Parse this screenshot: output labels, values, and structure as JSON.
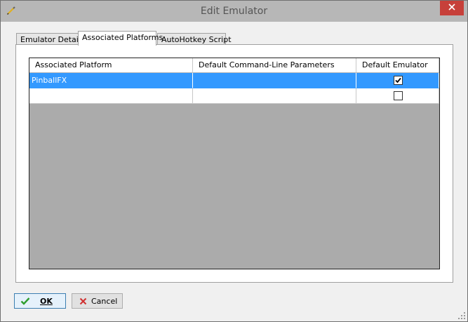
{
  "window": {
    "title": "Edit Emulator"
  },
  "tabs": [
    {
      "label": "Emulator Details",
      "active": false
    },
    {
      "label": "Associated Platforms",
      "active": true
    },
    {
      "label": "AutoHotkey Script",
      "active": false
    }
  ],
  "grid": {
    "columns": [
      "Associated Platform",
      "Default Command-Line Parameters",
      "Default Emulator"
    ],
    "rows": [
      {
        "platform": "PinballFX",
        "parameters": "",
        "default_emulator": true,
        "selected": true
      },
      {
        "platform": "",
        "parameters": "",
        "default_emulator": false,
        "selected": false
      }
    ]
  },
  "buttons": {
    "ok_label": "OK",
    "cancel_label": "Cancel"
  },
  "colors": {
    "titlebar": "#b7b7b7",
    "close": "#c7403a",
    "selection": "#3399ff",
    "grid_background": "#ababab",
    "ok_icon": "#2e9e2e",
    "cancel_icon": "#d03030"
  },
  "icons": {
    "app": "pencil-icon",
    "close": "close-icon",
    "ok": "checkmark-icon",
    "cancel": "x-icon",
    "resize": "resize-grip-icon"
  }
}
